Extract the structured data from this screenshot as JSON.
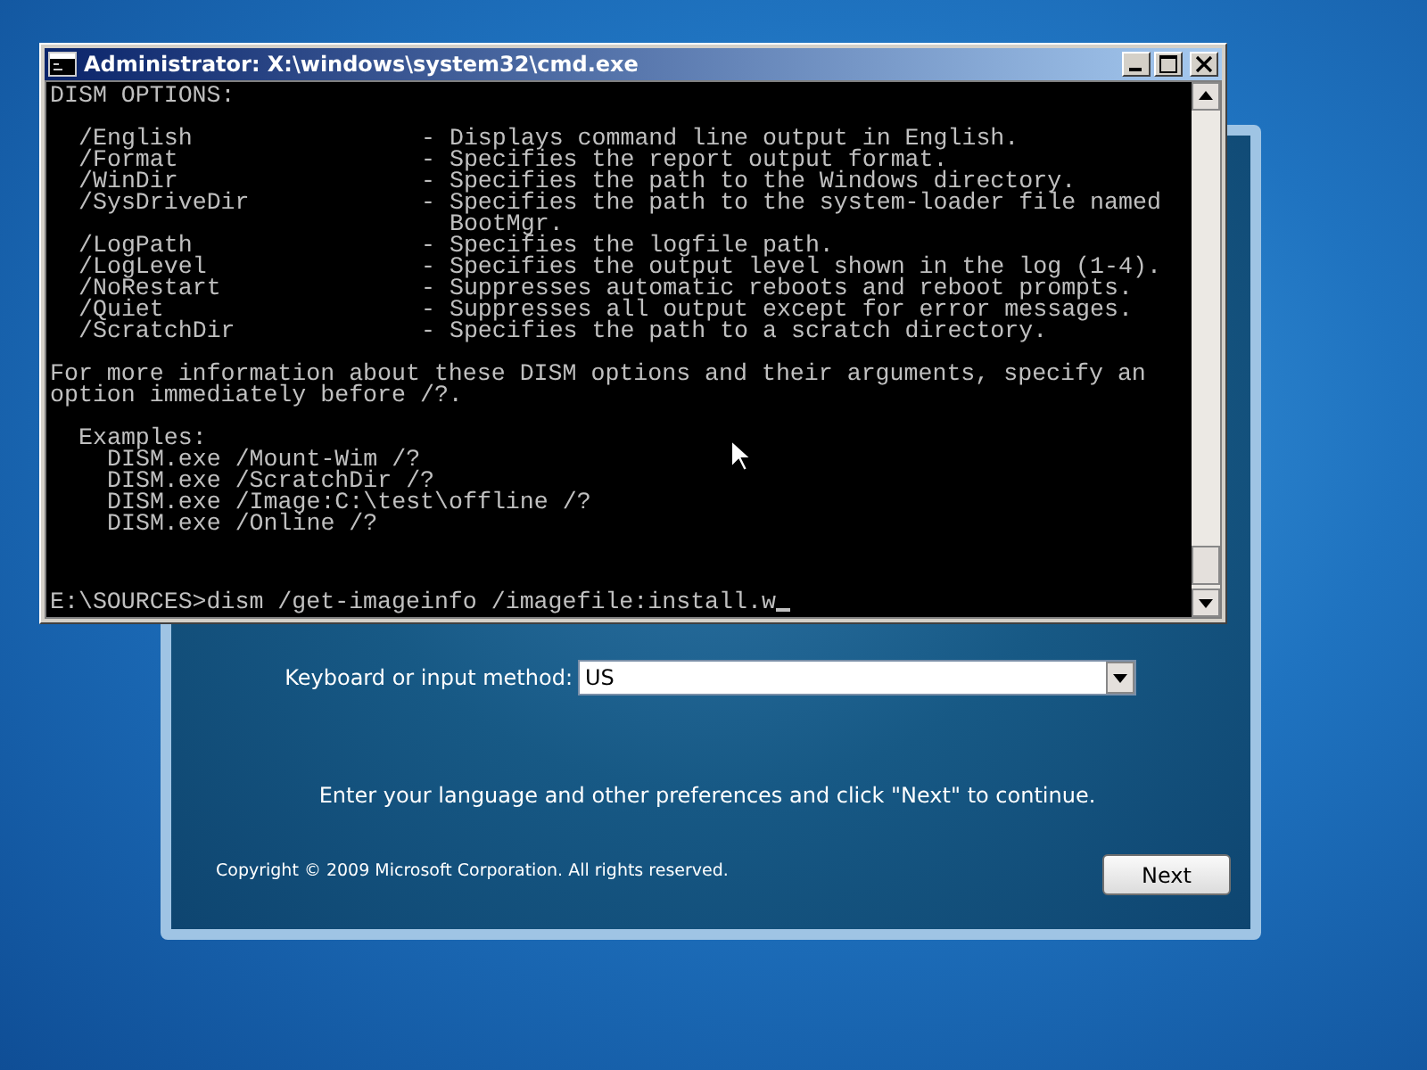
{
  "cmd_window": {
    "title": "Administrator: X:\\windows\\system32\\cmd.exe",
    "heading": "DISM OPTIONS:",
    "options": [
      {
        "option": "/English",
        "description": "- Displays command line output in English."
      },
      {
        "option": "/Format",
        "description": "- Specifies the report output format."
      },
      {
        "option": "/WinDir",
        "description": "- Specifies the path to the Windows directory."
      },
      {
        "option": "/SysDriveDir",
        "description": "- Specifies the path to the system-loader file named",
        "continuation": "BootMgr."
      },
      {
        "option": "/LogPath",
        "description": "- Specifies the logfile path."
      },
      {
        "option": "/LogLevel",
        "description": "- Specifies the output level shown in the log (1-4)."
      },
      {
        "option": "/NoRestart",
        "description": "- Suppresses automatic reboots and reboot prompts."
      },
      {
        "option": "/Quiet",
        "description": "- Suppresses all output except for error messages."
      },
      {
        "option": "/ScratchDir",
        "description": "- Specifies the path to a scratch directory."
      }
    ],
    "info": [
      "For more information about these DISM options and their arguments, specify an",
      "option immediately before /?."
    ],
    "examples_heading": "Examples:",
    "examples": [
      "DISM.exe /Mount-Wim /?",
      "DISM.exe /ScratchDir /?",
      "DISM.exe /Image:C:\\test\\offline /?",
      "DISM.exe /Online /?"
    ],
    "prompt": "E:\\SOURCES>dism /get-imageinfo /imagefile:install.w"
  },
  "setup_window": {
    "keyboard_label": "Keyboard or input method:",
    "keyboard_value": "US",
    "instruction": "Enter your language and other preferences and click \"Next\" to continue.",
    "copyright": "Copyright © 2009 Microsoft Corporation. All rights reserved.",
    "next_button": "Next"
  }
}
